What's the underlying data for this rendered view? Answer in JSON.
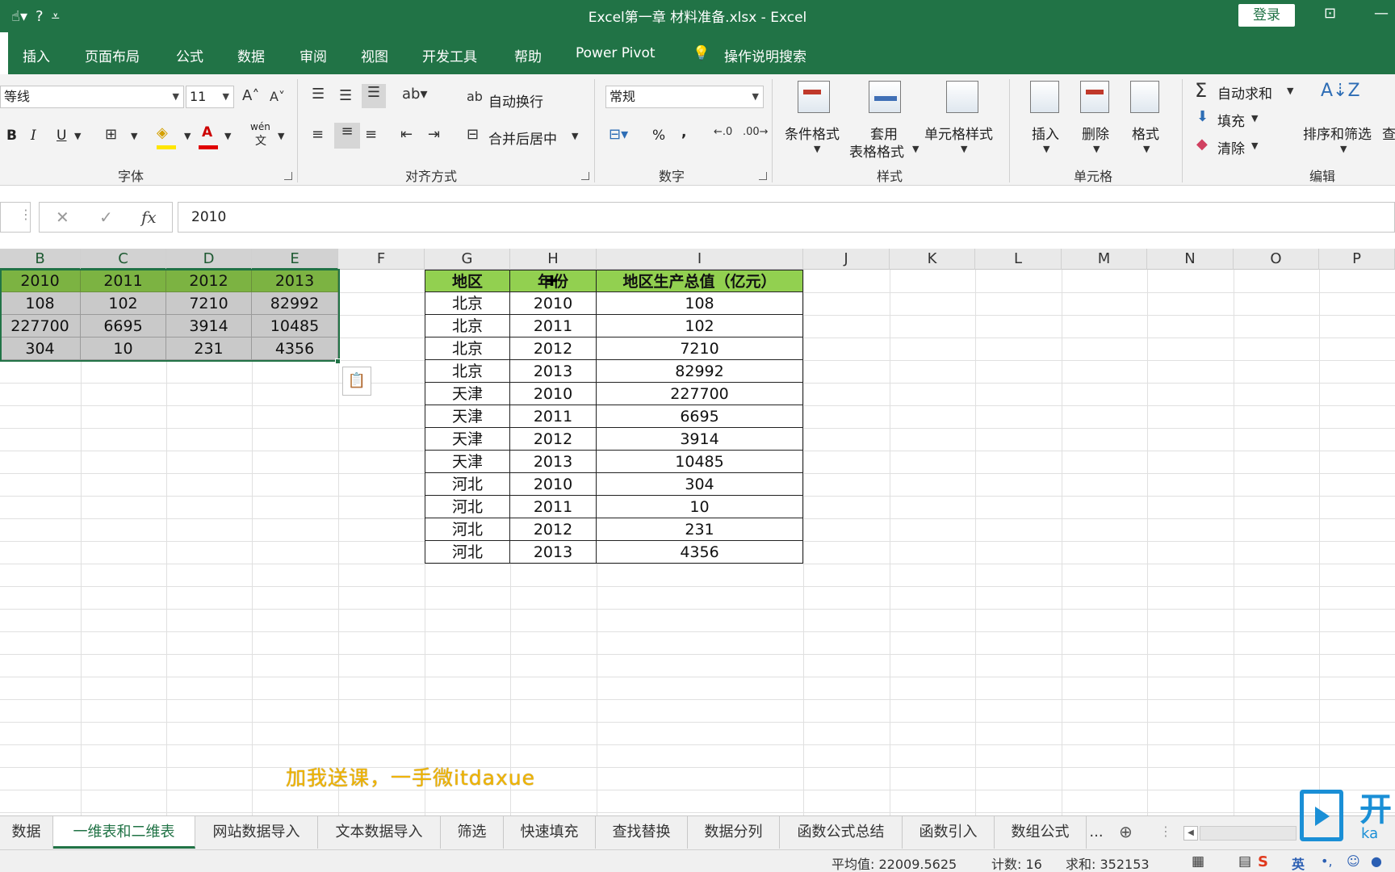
{
  "window": {
    "title": "Excel第一章 材料准备.xlsx  -  Excel",
    "login_label": "登录",
    "qat_icons": [
      "touch-icon",
      "help-icon",
      "customize-icon"
    ]
  },
  "ribbon_tabs": [
    "插入",
    "页面布局",
    "公式",
    "数据",
    "审阅",
    "视图",
    "开发工具",
    "帮助",
    "Power Pivot"
  ],
  "search_label": "操作说明搜索",
  "ribbon": {
    "font_name": "等线",
    "font_size": "11",
    "font_group": "字体",
    "align_group": "对齐方式",
    "wrap_text": "自动换行",
    "merge_center": "合并后居中",
    "number_format": "常规",
    "number_group": "数字",
    "cond_format": "条件格式",
    "table_format_1": "套用",
    "table_format_2": "表格格式",
    "cell_styles": "单元格样式",
    "styles_group": "样式",
    "insert": "插入",
    "delete": "删除",
    "format": "格式",
    "cells_group": "单元格",
    "autosum": "自动求和",
    "fill": "填充",
    "clear": "清除",
    "sort_filter": "排序和筛选",
    "find_partial": "查",
    "edit_group": "编辑",
    "bold": "B",
    "italic": "I",
    "underline": "U",
    "wen": "wén",
    "wen_char": "文",
    "percent": "%",
    "comma": ","
  },
  "formula_bar": {
    "value": "2010",
    "fx": "fx"
  },
  "columns": [
    "B",
    "C",
    "D",
    "E",
    "F",
    "G",
    "H",
    "I",
    "J",
    "K",
    "L",
    "M",
    "N",
    "O",
    "P"
  ],
  "source_table": {
    "header": [
      "2010",
      "2011",
      "2012",
      "2013"
    ],
    "rows": [
      [
        "108",
        "102",
        "7210",
        "82992"
      ],
      [
        "227700",
        "6695",
        "3914",
        "10485"
      ],
      [
        "304",
        "10",
        "231",
        "4356"
      ]
    ]
  },
  "output_table": {
    "header": [
      "地区",
      "年份",
      "地区生产总值（亿元）"
    ],
    "rows": [
      [
        "北京",
        "2010",
        "108"
      ],
      [
        "北京",
        "2011",
        "102"
      ],
      [
        "北京",
        "2012",
        "7210"
      ],
      [
        "北京",
        "2013",
        "82992"
      ],
      [
        "天津",
        "2010",
        "227700"
      ],
      [
        "天津",
        "2011",
        "6695"
      ],
      [
        "天津",
        "2012",
        "3914"
      ],
      [
        "天津",
        "2013",
        "10485"
      ],
      [
        "河北",
        "2010",
        "304"
      ],
      [
        "河北",
        "2011",
        "10"
      ],
      [
        "河北",
        "2012",
        "231"
      ],
      [
        "河北",
        "2013",
        "4356"
      ]
    ]
  },
  "overlay_text": "加我送课，一手微itdaxue",
  "sheet_tabs": [
    "数据",
    "一维表和二维表",
    "网站数据导入",
    "文本数据导入",
    "筛选",
    "快速填充",
    "查找替换",
    "数据分列",
    "函数公式总结",
    "函数引入",
    "数组公式"
  ],
  "active_sheet": "一维表和二维表",
  "sheet_more": "...",
  "status": {
    "average": "平均值: 22009.5625",
    "count": "计数: 16",
    "sum": "求和: 352153",
    "ime": "英"
  },
  "logo_text": "开",
  "logo_sub": "ka"
}
